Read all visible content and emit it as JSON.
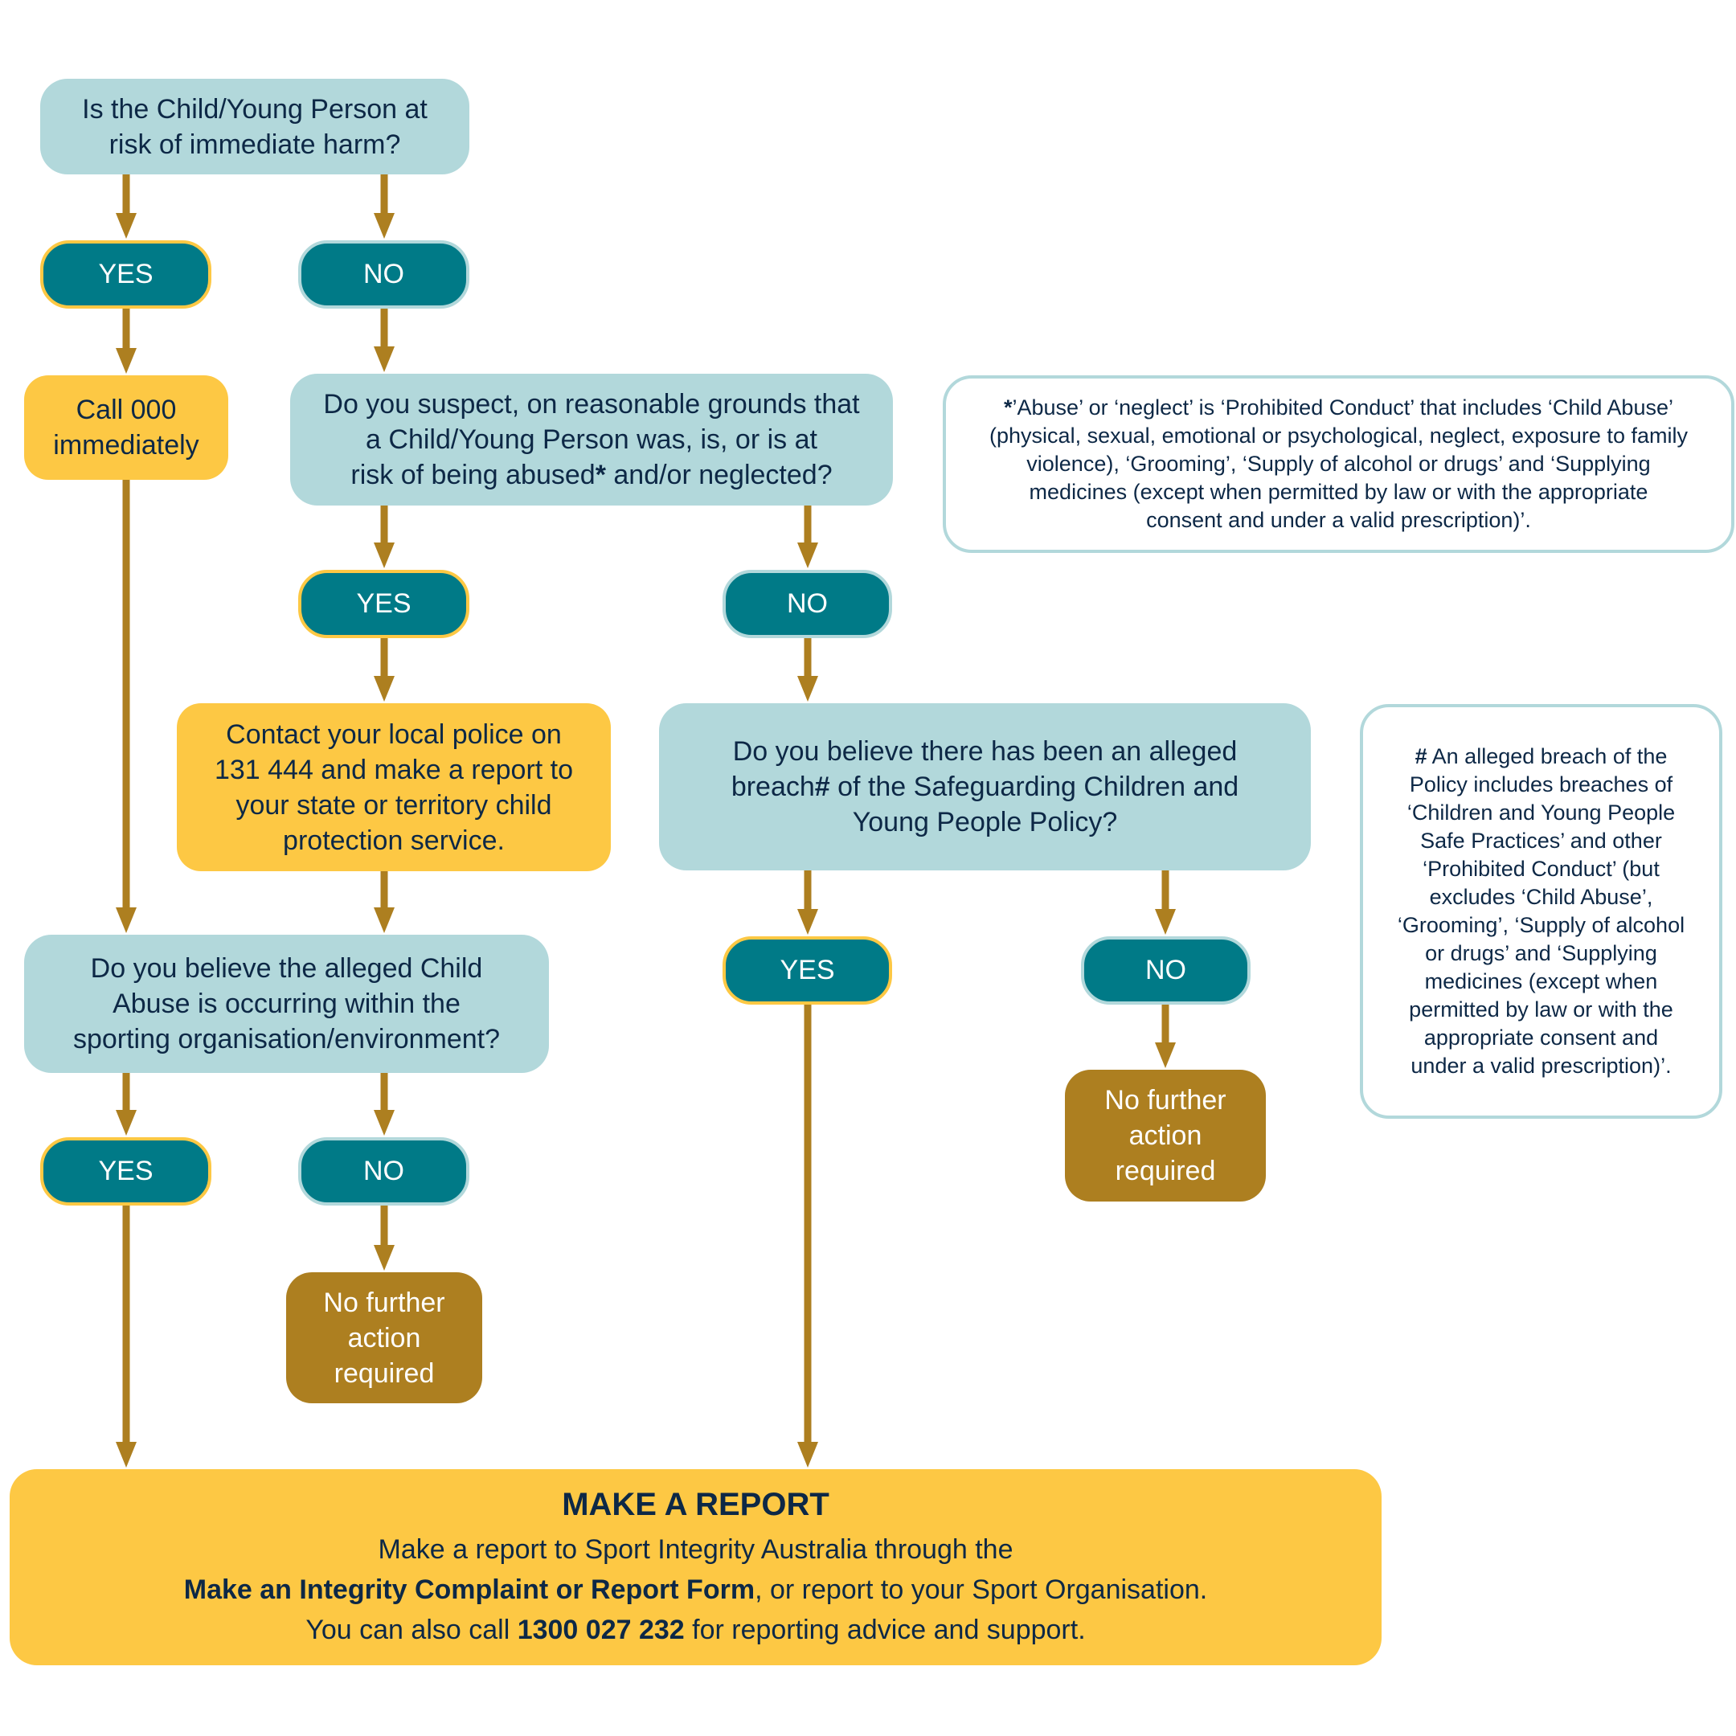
{
  "colors": {
    "question_bg": "#b2d8db",
    "pill_bg": "#007a87",
    "yes_border": "#fdc844",
    "action_yellow": "#fdc844",
    "no_action_brown": "#ad7f20",
    "arrow": "#ad7f20",
    "text_navy": "#0d2846"
  },
  "nodes": {
    "q1": {
      "line1": "Is the Child/Young Person at",
      "line2": "risk of immediate harm?"
    },
    "q1_yes": "YES",
    "q1_no": "NO",
    "call000": {
      "line1": "Call 000",
      "line2": "immediately"
    },
    "q2": {
      "line1": "Do you suspect, on reasonable grounds that",
      "line2": "a Child/Young Person was, is, or is at",
      "line3a": "risk of being abused",
      "line3b": "*",
      "line3c": " and/or neglected?"
    },
    "q2_yes": "YES",
    "q2_no": "NO",
    "police": {
      "line1": "Contact your local police on",
      "line2": "131 444 and make a report to",
      "line3": "your state or territory child",
      "line4": "protection service."
    },
    "q3": {
      "line1": "Do you believe there has been an alleged",
      "line2a": "breach",
      "line2b": "#",
      "line2c": " of the Safeguarding Children and",
      "line3": "Young People Policy?"
    },
    "q3_yes": "YES",
    "q3_no": "NO",
    "q3_no_action": {
      "line1": "No further",
      "line2": "action",
      "line3": "required"
    },
    "q4": {
      "line1": "Do you believe the alleged Child",
      "line2": "Abuse is occurring within the",
      "line3": "sporting organisation/environment?"
    },
    "q4_yes": "YES",
    "q4_no": "NO",
    "q4_no_action": {
      "line1": "No further",
      "line2": "action",
      "line3": "required"
    }
  },
  "notes": {
    "abuse": {
      "marker": "*",
      "lines": [
        "’Abuse’ or ‘neglect’ is ‘Prohibited Conduct’ that includes ‘Child Abuse’",
        "(physical, sexual, emotional or psychological, neglect, exposure to family",
        "violence), ‘Grooming’, ‘Supply of alcohol or drugs’ and ‘Supplying",
        "medicines (except when permitted by law or with the appropriate",
        "consent and under a valid prescription)’."
      ]
    },
    "breach": {
      "marker": "#",
      "lines": [
        " An alleged breach of the",
        "Policy includes breaches of",
        "‘Children and Young People",
        "Safe Practices’ and other",
        "‘Prohibited Conduct’ (but",
        "excludes ‘Child Abuse’,",
        "‘Grooming’, ‘Supply of alcohol",
        "or drugs’ and ‘Supplying",
        "medicines (except when",
        "permitted by law or with the",
        "appropriate consent and",
        "under a valid prescription)’."
      ]
    }
  },
  "report": {
    "title": "MAKE A REPORT",
    "line1": "Make a report to Sport Integrity Australia through the",
    "form_link": "Make an Integrity Complaint or Report Form",
    "line2_rest": ", or report to your Sport Organisation.",
    "line3_pre": "You can also call ",
    "phone": "1300 027 232",
    "line3_post": " for reporting advice and support."
  }
}
